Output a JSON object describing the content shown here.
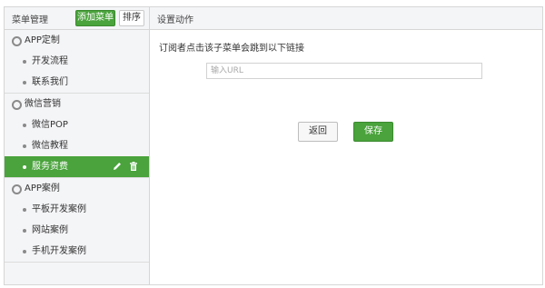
{
  "sidebar": {
    "title": "菜单管理",
    "add_label": "添加菜单",
    "sort_label": "排序",
    "groups": [
      {
        "label": "APP定制",
        "items": [
          "开发流程",
          "联系我们"
        ]
      },
      {
        "label": "微信营销",
        "items": [
          "微信POP",
          "微信教程",
          "服务资费"
        ]
      },
      {
        "label": "APP案例",
        "items": [
          "平板开发案例",
          "网站案例",
          "手机开发案例"
        ]
      }
    ]
  },
  "main": {
    "title": "设置动作",
    "description": "订阅者点击该子菜单会跳到以下链接",
    "url_placeholder": "输入URL",
    "url_value": "",
    "back_label": "返回",
    "save_label": "保存"
  },
  "colors": {
    "accent": "#4aa33c",
    "border": "#d6d6d6",
    "panel": "#f4f5f7"
  },
  "icons": [
    "gear-icon",
    "bullet-icon",
    "edit-icon",
    "trash-icon"
  ]
}
